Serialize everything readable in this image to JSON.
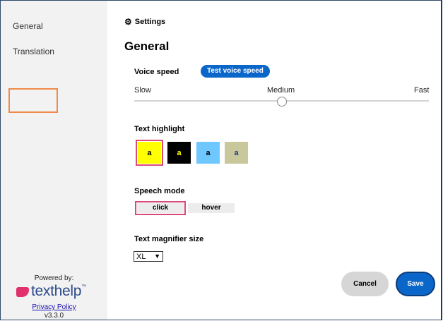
{
  "sidebar": {
    "items": [
      {
        "label": "General"
      },
      {
        "label": "Translation"
      }
    ],
    "powered_by": "Powered by:",
    "logo_text": "texthelp",
    "logo_tm": "™",
    "privacy_link": "Privacy Policy",
    "version": "v3.3.0"
  },
  "header": {
    "breadcrumb_icon": "gear-icon",
    "breadcrumb": "Settings",
    "title": "General"
  },
  "voice_speed": {
    "label": "Voice speed",
    "test_button": "Test voice speed",
    "slow": "Slow",
    "medium": "Medium",
    "fast": "Fast",
    "level": 0.5
  },
  "text_highlight": {
    "label": "Text highlight",
    "swatches": [
      {
        "text": "a",
        "bg": "#ffff00",
        "fg": "#000000",
        "selected": true
      },
      {
        "text": "a",
        "bg": "#000000",
        "fg": "#ffff00",
        "selected": false
      },
      {
        "text": "a",
        "bg": "#6ec8ff",
        "fg": "#000000",
        "selected": false
      },
      {
        "text": "a",
        "bg": "#c9c89c",
        "fg": "#1f3a8a",
        "selected": false
      }
    ]
  },
  "speech_mode": {
    "label": "Speech mode",
    "options": [
      {
        "label": "click",
        "selected": true
      },
      {
        "label": "hover",
        "selected": false
      }
    ]
  },
  "magnifier": {
    "label": "Text magnifier size",
    "selected": "XL"
  },
  "actions": {
    "cancel": "Cancel",
    "save": "Save"
  },
  "colors": {
    "accent": "#0a66c8",
    "focus_ring": "#d94a77",
    "sidebar_focus": "#f08a4b",
    "brand": "#e1306c"
  }
}
